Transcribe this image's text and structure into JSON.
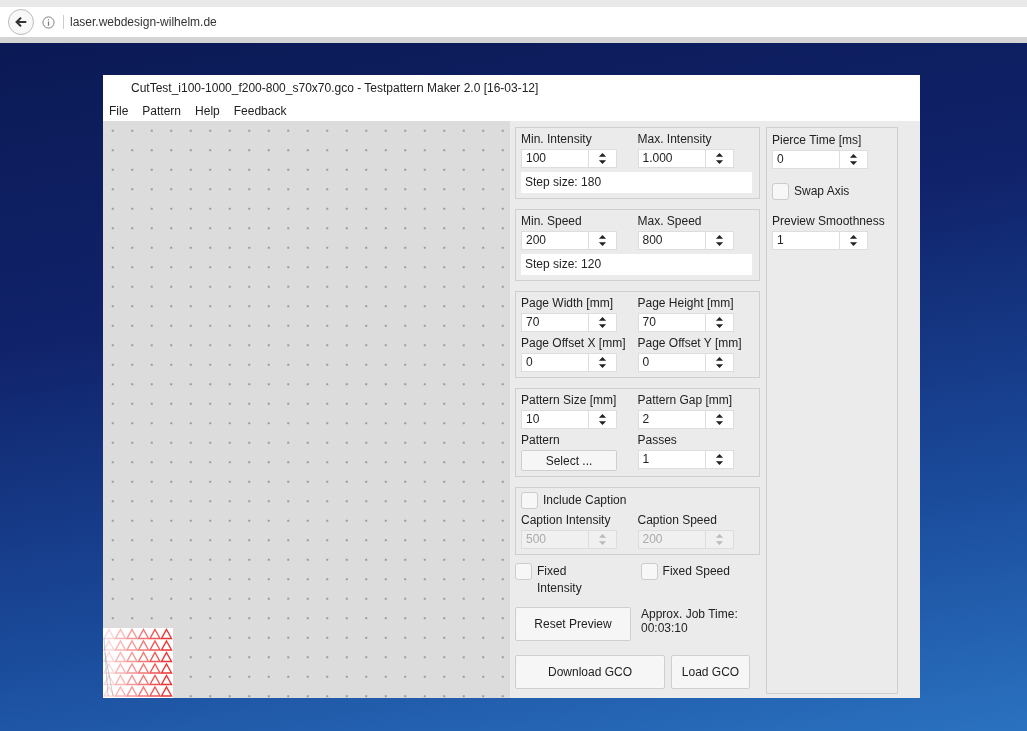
{
  "browser": {
    "url": "laser.webdesign-wilhelm.de"
  },
  "window": {
    "title": "CutTest_i100-1000_f200-800_s70x70.gco - Testpattern Maker 2.0 [16-03-12]"
  },
  "menu": [
    "File",
    "Pattern",
    "Help",
    "Feedback"
  ],
  "groups": [
    {
      "rows": [
        [
          {
            "kind": "spinner",
            "label": "Min. Intensity",
            "value": "100",
            "disabled": false
          },
          {
            "kind": "spinner",
            "label": "Max. Intensity",
            "value": "1.000",
            "disabled": false
          }
        ],
        [
          {
            "kind": "note",
            "text": "Step size: 180"
          }
        ]
      ]
    },
    {
      "rows": [
        [
          {
            "kind": "spinner",
            "label": "Min. Speed",
            "value": "200",
            "disabled": false
          },
          {
            "kind": "spinner",
            "label": "Max. Speed",
            "value": "800",
            "disabled": false
          }
        ],
        [
          {
            "kind": "note",
            "text": "Step size: 120"
          }
        ]
      ]
    },
    {
      "rows": [
        [
          {
            "kind": "spinner",
            "label": "Page Width [mm]",
            "value": "70",
            "disabled": false
          },
          {
            "kind": "spinner",
            "label": "Page Height [mm]",
            "value": "70",
            "disabled": false
          }
        ],
        [
          {
            "kind": "spinner",
            "label": "Page Offset X [mm]",
            "value": "0",
            "disabled": false
          },
          {
            "kind": "spinner",
            "label": "Page Offset Y [mm]",
            "value": "0",
            "disabled": false
          }
        ]
      ]
    },
    {
      "rows": [
        [
          {
            "kind": "spinner",
            "label": "Pattern Size [mm]",
            "value": "10",
            "disabled": false
          },
          {
            "kind": "spinner",
            "label": "Pattern Gap [mm]",
            "value": "2",
            "disabled": false
          }
        ],
        [
          {
            "kind": "select",
            "label": "Pattern",
            "button": "Select ..."
          },
          {
            "kind": "spinner",
            "label": "Passes",
            "value": "1",
            "disabled": false
          }
        ]
      ]
    },
    {
      "rows": [
        [
          {
            "kind": "checkbox",
            "label": "Include Caption",
            "checked": false
          }
        ],
        [
          {
            "kind": "spinner",
            "label": "Caption Intensity",
            "value": "500",
            "disabled": true
          },
          {
            "kind": "spinner",
            "label": "Caption Speed",
            "value": "200",
            "disabled": true
          }
        ]
      ]
    }
  ],
  "fixed": [
    {
      "label": "Fixed Intensity",
      "checked": false
    },
    {
      "label": "Fixed Speed",
      "checked": false
    }
  ],
  "reset_button": "Reset Preview",
  "job_time": {
    "label": "Approx. Job Time:",
    "value": "00:03:10"
  },
  "download_button": "Download GCO",
  "load_button": "Load GCO",
  "side": [
    {
      "kind": "spinner",
      "label": "Pierce Time [ms]",
      "value": "0",
      "disabled": false
    },
    {
      "kind": "checkbox",
      "label": "Swap Axis",
      "checked": false
    },
    {
      "kind": "spinner",
      "label": "Preview Smoothness",
      "value": "1",
      "disabled": false
    }
  ]
}
